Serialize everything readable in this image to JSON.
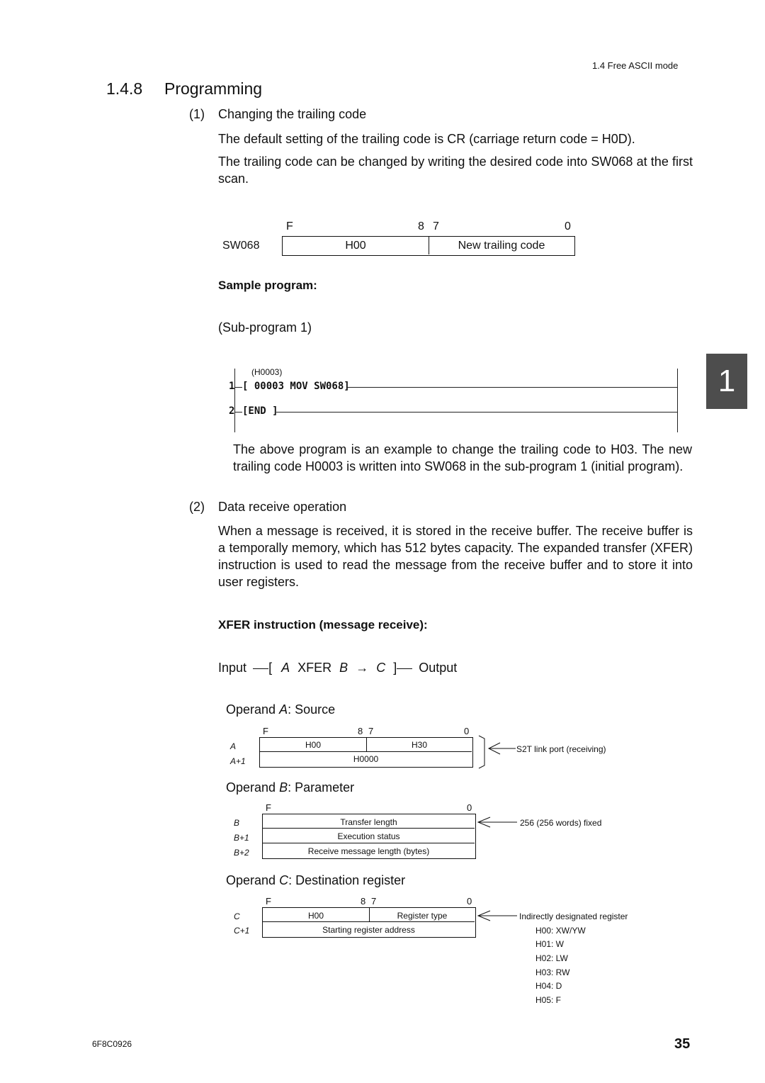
{
  "header": {
    "section_ref": "1.4  Free ASCII mode"
  },
  "section": {
    "number": "1.4.8",
    "title": "Programming"
  },
  "item1": {
    "number": "(1)",
    "title": "Changing the trailing code",
    "para1": "The default setting of the trailing code is CR (carriage return code = H0D).",
    "para2": "The trailing code can be changed by writing the desired code into SW068 at the first scan."
  },
  "sw068_diagram": {
    "register": "SW068",
    "bits": {
      "f": "F",
      "b8": "8",
      "b7": "7",
      "b0": "0"
    },
    "upper": "H00",
    "lower": "New trailing code"
  },
  "sample": {
    "heading": "Sample program:",
    "subprogram": "(Sub-program 1)"
  },
  "ladder": {
    "rung1_number": "1",
    "rung1_comment": "(H0003)",
    "rung1_instruction": "[ 00003 MOV SW068]",
    "rung2_number": "2",
    "rung2_instruction": "[END ]"
  },
  "explanation": "The above program is an example to change the trailing code to H03. The new trailing code H0003 is written into SW068 in the sub-program 1 (initial program).",
  "item2": {
    "number": "(2)",
    "title": "Data receive operation",
    "para": "When a message is received, it is stored in the receive buffer. The receive buffer is a temporally memory, which has 512 bytes capacity. The expanded transfer (XFER) instruction is used to read the message from the receive buffer and to store it into user registers."
  },
  "xfer": {
    "heading": "XFER instruction (message receive):",
    "input": "Input",
    "a": "A",
    "op": "XFER",
    "b": "B",
    "arrow": "→",
    "c": "C",
    "output": "Output"
  },
  "operand_a": {
    "title_prefix": "Operand ",
    "letter": "A",
    "title_suffix": ": Source",
    "bits": {
      "f": "F",
      "b8": "8",
      "b7": "7",
      "b0": "0"
    },
    "rows": [
      {
        "label": "A",
        "upper": "H00",
        "lower": "H30"
      },
      {
        "label": "A+1",
        "full": "H0000"
      }
    ],
    "note": "S2T link port (receiving)"
  },
  "operand_b": {
    "title_prefix": "Operand ",
    "letter": "B",
    "title_suffix": ": Parameter",
    "bits": {
      "f": "F",
      "b0": "0"
    },
    "rows": [
      {
        "label": "B",
        "full": "Transfer length"
      },
      {
        "label": "B+1",
        "full": "Execution status"
      },
      {
        "label": "B+2",
        "full": "Receive message length (bytes)"
      }
    ],
    "note": "256 (256 words) fixed"
  },
  "operand_c": {
    "title_prefix": "Operand ",
    "letter": "C",
    "title_suffix": ": Destination register",
    "bits": {
      "f": "F",
      "b8": "8",
      "b7": "7",
      "b0": "0"
    },
    "rows": [
      {
        "label": "C",
        "upper": "H00",
        "lower": "Register type"
      },
      {
        "label": "C+1",
        "full": "Starting register address"
      }
    ],
    "note": "Indirectly designated register",
    "codes": [
      "H00: XW/YW",
      "H01: W",
      "H02: LW",
      "H03: RW",
      "H04: D",
      "H05: F"
    ]
  },
  "chapter_tab": "1",
  "footer": {
    "doc_id": "6F8C0926",
    "page": "35"
  }
}
